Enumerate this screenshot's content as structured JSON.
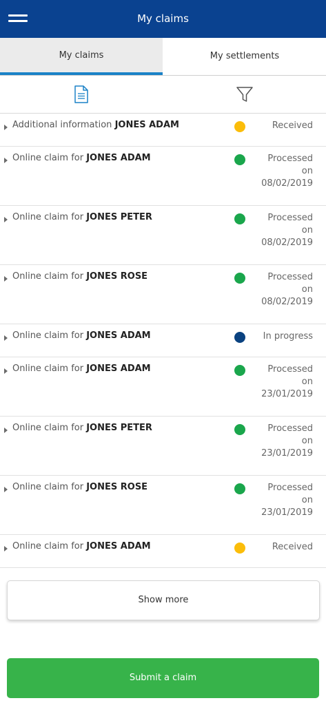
{
  "header": {
    "title": "My claims",
    "menu_icon": "hamburger-menu-icon",
    "background_color": "#0a4290"
  },
  "tabs": [
    {
      "label": "My claims",
      "active": true
    },
    {
      "label": "My settlements",
      "active": false
    }
  ],
  "toolbar": {
    "document_icon": "document-icon",
    "filter_icon": "filter-icon",
    "accent_color": "#1b82c7"
  },
  "status_colors": {
    "received": "#fbbd0a",
    "processed": "#1aa64c",
    "in_progress": "#0a4280"
  },
  "claims": [
    {
      "prefix": "Additional information ",
      "name": "JONES ADAM",
      "status": "received",
      "status_lines": [
        "Received"
      ]
    },
    {
      "prefix": "Online claim for ",
      "name": "JONES ADAM",
      "status": "processed",
      "status_lines": [
        "Processed",
        "on",
        "08/02/2019"
      ]
    },
    {
      "prefix": "Online claim for ",
      "name": "JONES PETER",
      "status": "processed",
      "status_lines": [
        "Processed",
        "on",
        "08/02/2019"
      ]
    },
    {
      "prefix": "Online claim for ",
      "name": "JONES ROSE",
      "status": "processed",
      "status_lines": [
        "Processed",
        "on",
        "08/02/2019"
      ]
    },
    {
      "prefix": "Online claim for ",
      "name": "JONES ADAM",
      "status": "in_progress",
      "status_lines": [
        "In progress"
      ]
    },
    {
      "prefix": "Online claim for ",
      "name": "JONES ADAM",
      "status": "processed",
      "status_lines": [
        "Processed",
        "on",
        "23/01/2019"
      ]
    },
    {
      "prefix": "Online claim for ",
      "name": "JONES PETER",
      "status": "processed",
      "status_lines": [
        "Processed",
        "on",
        "23/01/2019"
      ]
    },
    {
      "prefix": "Online claim for ",
      "name": "JONES ROSE",
      "status": "processed",
      "status_lines": [
        "Processed",
        "on",
        "23/01/2019"
      ]
    },
    {
      "prefix": "Online claim for ",
      "name": "JONES ADAM",
      "status": "received",
      "status_lines": [
        "Received"
      ]
    }
  ],
  "actions": {
    "show_more_label": "Show more",
    "submit_label": "Submit a claim",
    "submit_color": "#37b34a"
  }
}
